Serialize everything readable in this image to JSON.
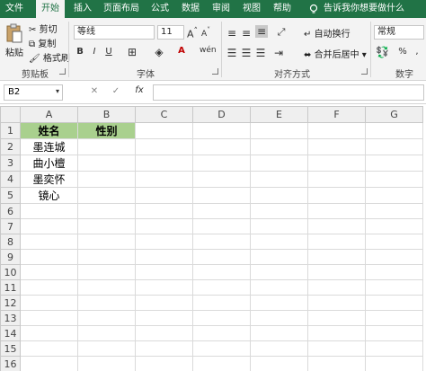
{
  "menubar": {
    "tabs": [
      "文件",
      "开始",
      "插入",
      "页面布局",
      "公式",
      "数据",
      "审阅",
      "视图",
      "帮助"
    ],
    "active": "开始",
    "tell_me": "告诉我你想要做什么"
  },
  "ribbon": {
    "clipboard": {
      "paste": "粘贴",
      "cut": "剪切",
      "copy": "复制",
      "format_painter": "格式刷",
      "label": "剪贴板"
    },
    "font": {
      "font_name": "等线",
      "font_size": "11",
      "label": "字体",
      "bold": "B",
      "italic": "I",
      "underline": "U"
    },
    "alignment": {
      "wrap_text": "自动换行",
      "merge_center": "合并后居中",
      "label": "对齐方式"
    },
    "number": {
      "format": "常规",
      "percent": "%",
      "label": "数字"
    }
  },
  "formula_bar": {
    "cell_ref": "B2",
    "fx": "fx",
    "value": ""
  },
  "sheet": {
    "columns": [
      "A",
      "B",
      "C",
      "D",
      "E",
      "F",
      "G"
    ],
    "rows": [
      [
        "姓名",
        "性别",
        "",
        "",
        "",
        "",
        ""
      ],
      [
        "墨连城",
        "",
        "",
        "",
        "",
        "",
        ""
      ],
      [
        "曲小檀",
        "",
        "",
        "",
        "",
        "",
        ""
      ],
      [
        "墨奕怀",
        "",
        "",
        "",
        "",
        "",
        ""
      ],
      [
        "镜心",
        "",
        "",
        "",
        "",
        "",
        ""
      ],
      [
        "",
        "",
        "",
        "",
        "",
        "",
        ""
      ],
      [
        "",
        "",
        "",
        "",
        "",
        "",
        ""
      ],
      [
        "",
        "",
        "",
        "",
        "",
        "",
        ""
      ],
      [
        "",
        "",
        "",
        "",
        "",
        "",
        ""
      ],
      [
        "",
        "",
        "",
        "",
        "",
        "",
        ""
      ],
      [
        "",
        "",
        "",
        "",
        "",
        "",
        ""
      ],
      [
        "",
        "",
        "",
        "",
        "",
        "",
        ""
      ],
      [
        "",
        "",
        "",
        "",
        "",
        "",
        ""
      ],
      [
        "",
        "",
        "",
        "",
        "",
        "",
        ""
      ],
      [
        "",
        "",
        "",
        "",
        "",
        "",
        ""
      ],
      [
        "",
        "",
        "",
        "",
        "",
        "",
        ""
      ]
    ],
    "header_fill": "#a9d08e"
  }
}
